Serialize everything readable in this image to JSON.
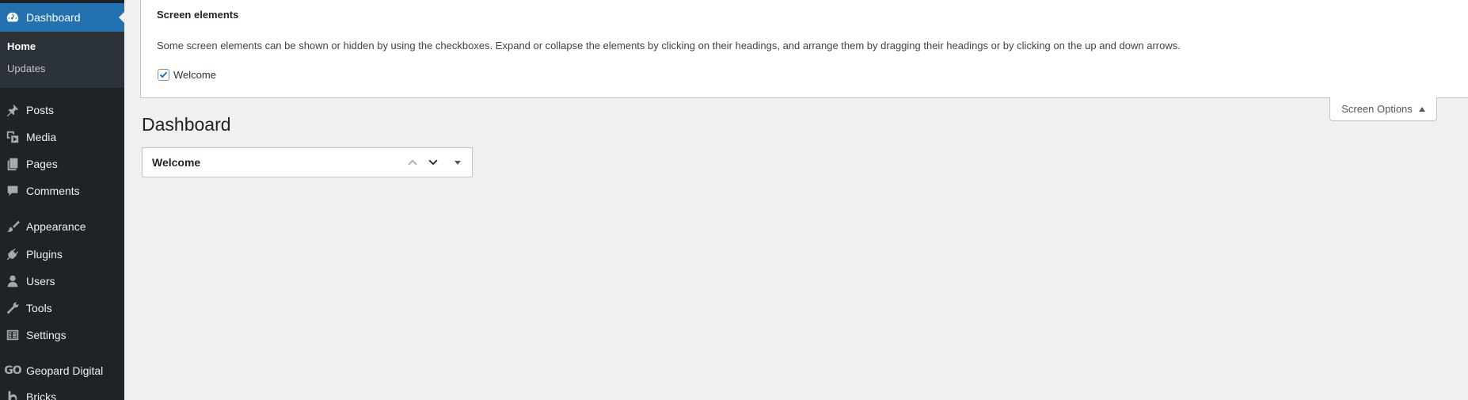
{
  "sidebar": {
    "current": {
      "label": "Dashboard",
      "icon": "dashboard-icon"
    },
    "submenu": [
      {
        "label": "Home",
        "active": true
      },
      {
        "label": "Updates",
        "active": false
      }
    ],
    "items": [
      {
        "label": "Posts",
        "icon": "pushpin-icon"
      },
      {
        "label": "Media",
        "icon": "media-icon"
      },
      {
        "label": "Pages",
        "icon": "pages-icon"
      },
      {
        "label": "Comments",
        "icon": "comments-icon"
      },
      {
        "label": "Appearance",
        "icon": "paintbrush-icon"
      },
      {
        "label": "Plugins",
        "icon": "plugin-icon"
      },
      {
        "label": "Users",
        "icon": "users-icon"
      },
      {
        "label": "Tools",
        "icon": "wrench-icon"
      },
      {
        "label": "Settings",
        "icon": "settings-icon"
      },
      {
        "label": "Geopard Digital",
        "icon": "go-logo-icon",
        "icon_text": "GO"
      },
      {
        "label": "Bricks",
        "icon": "bricks-icon"
      }
    ]
  },
  "screen_options": {
    "title": "Screen elements",
    "description": "Some screen elements can be shown or hidden by using the checkboxes. Expand or collapse the elements by clicking on their headings, and arrange them by dragging their headings or by clicking on the up and down arrows.",
    "checkbox_label": "Welcome",
    "checkbox_checked": true,
    "tab_label": "Screen Options"
  },
  "main": {
    "page_title": "Dashboard",
    "widget_title": "Welcome"
  },
  "colors": {
    "sidebar_bg": "#1d2327",
    "accent": "#2271b1",
    "page_bg": "#f0f0f1"
  }
}
